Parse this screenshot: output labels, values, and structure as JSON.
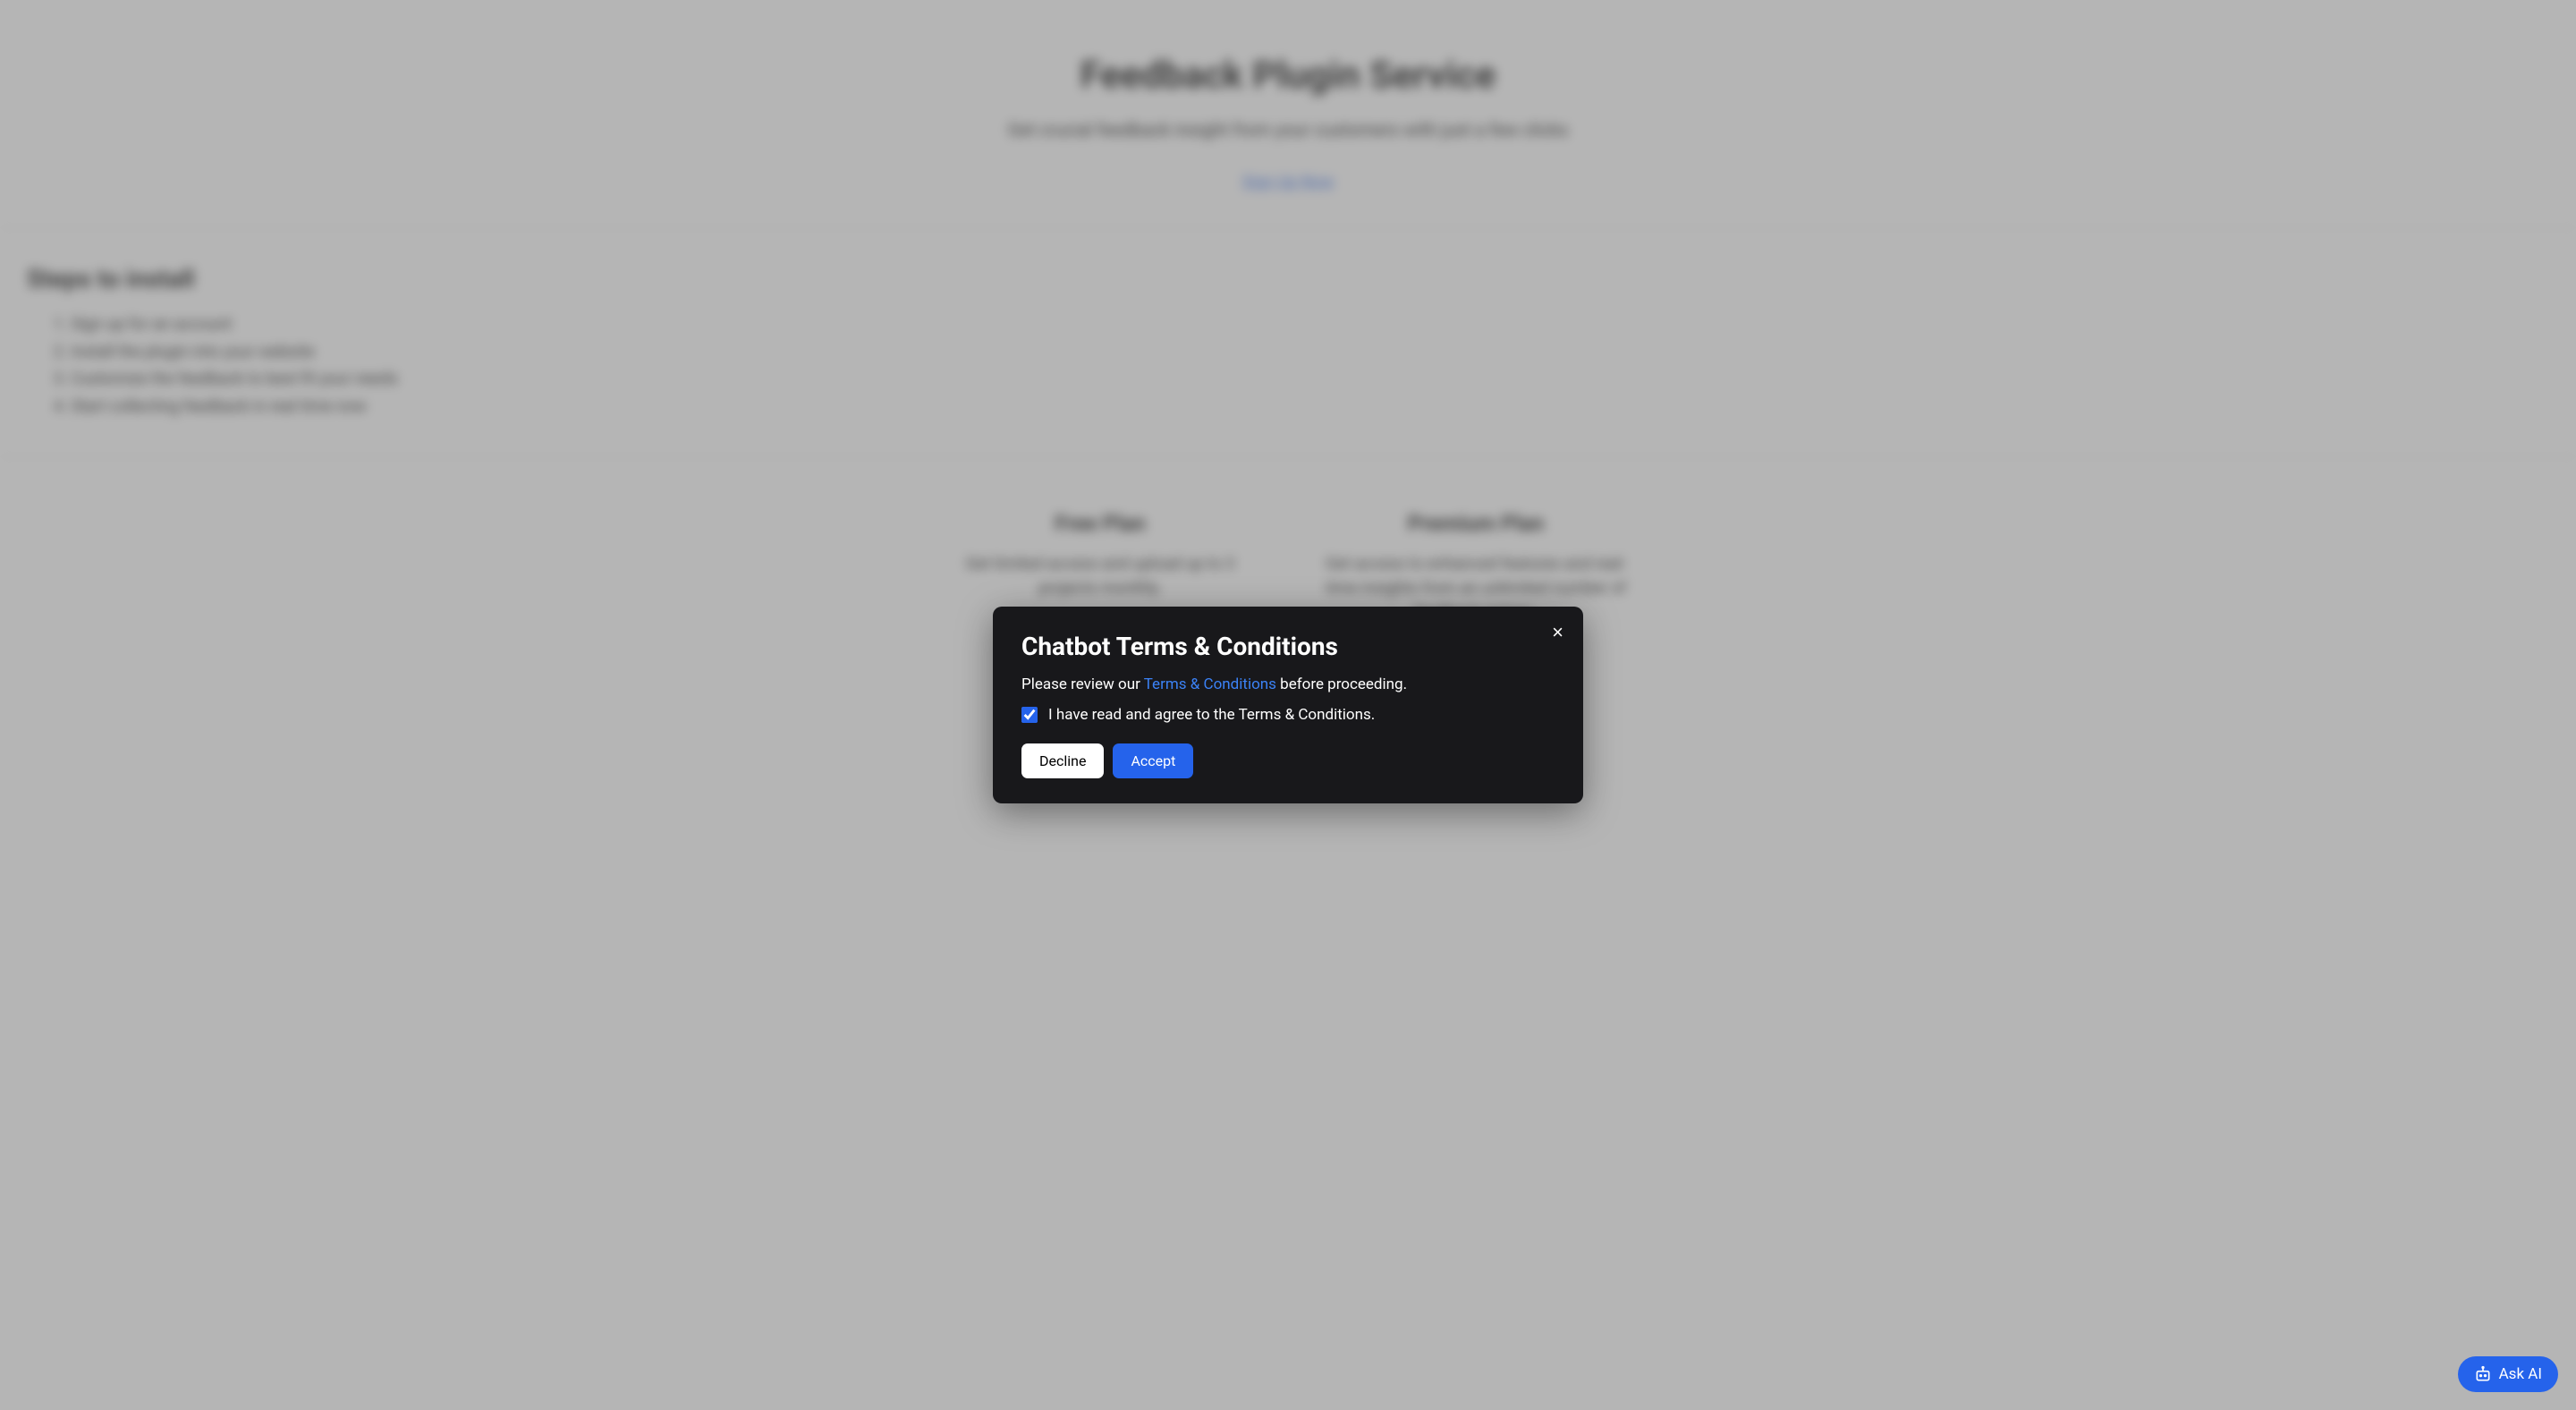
{
  "hero": {
    "title": "Feedback Plugin Service",
    "subtitle": "Get crucial feedback insight from your customers with just a few clicks",
    "cta": "Sign Up Now"
  },
  "steps": {
    "heading": "Steps to install",
    "items": [
      "Sign up for an account",
      "Install the plugin into your website",
      "Customize the feedback to best fit your needs",
      "Start collecting feedback in real time now"
    ]
  },
  "plans": {
    "free": {
      "title": "Free Plan",
      "description": "Get limited access and upload up to 3 projects monthly."
    },
    "premium": {
      "title": "Premium Plan",
      "description": "Get access to enhanced features and real-time insights from an unlimited number of feedback entries."
    }
  },
  "modal": {
    "title": "Chatbot Terms & Conditions",
    "intro_prefix": "Please review our ",
    "intro_link": "Terms & Conditions",
    "intro_suffix": " before proceeding.",
    "checkbox_label": "I have read and agree to the Terms & Conditions.",
    "checkbox_checked": true,
    "decline_label": "Decline",
    "accept_label": "Accept",
    "close_label": "×"
  },
  "ask_ai": {
    "label": "Ask AI"
  }
}
